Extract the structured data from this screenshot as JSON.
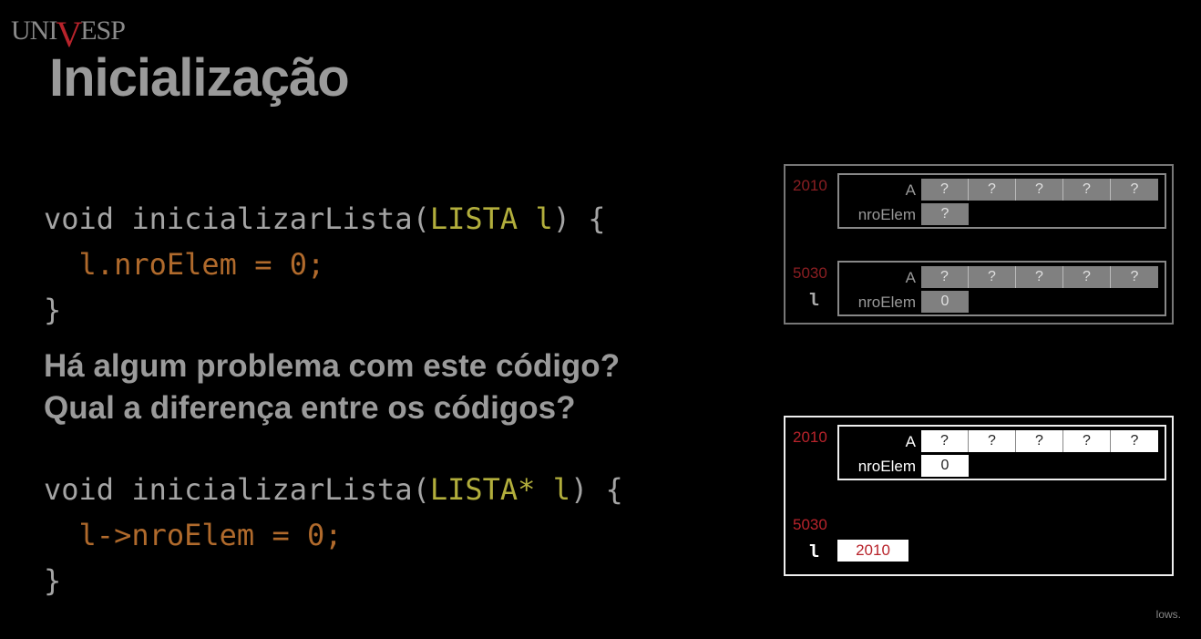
{
  "logo": {
    "prefix": "UNI",
    "v": "V",
    "suffix": "ESP"
  },
  "title": "Inicialização",
  "code1": {
    "line1_a": "void inicializarLista(",
    "line1_type": "LISTA l",
    "line1_b": ") {",
    "line2": "  l.nroElem = 0;",
    "line3": "}"
  },
  "questions": [
    "Há algum problema com este código?",
    "Qual a diferença entre os códigos?"
  ],
  "code2": {
    "line1_a": "void inicializarLista(",
    "line1_type": "LISTA* l",
    "line1_b": ") {",
    "line2": "  l->nroElem = 0;",
    "line3": "}"
  },
  "diagram1": {
    "struct_a": {
      "address": "2010",
      "field_a_label": "A",
      "field_a_values": [
        "?",
        "?",
        "?",
        "?",
        "?"
      ],
      "field_n_label": "nroElem",
      "field_n_value": "?"
    },
    "struct_b": {
      "address": "5030",
      "var": "l",
      "field_a_label": "A",
      "field_a_values": [
        "?",
        "?",
        "?",
        "?",
        "?"
      ],
      "field_n_label": "nroElem",
      "field_n_value": "0"
    }
  },
  "diagram2": {
    "struct": {
      "address": "2010",
      "field_a_label": "A",
      "field_a_values": [
        "?",
        "?",
        "?",
        "?",
        "?"
      ],
      "field_n_label": "nroElem",
      "field_n_value": "0"
    },
    "pointer": {
      "address": "5030",
      "var": "l",
      "value": "2010"
    }
  },
  "watermark": "lows."
}
